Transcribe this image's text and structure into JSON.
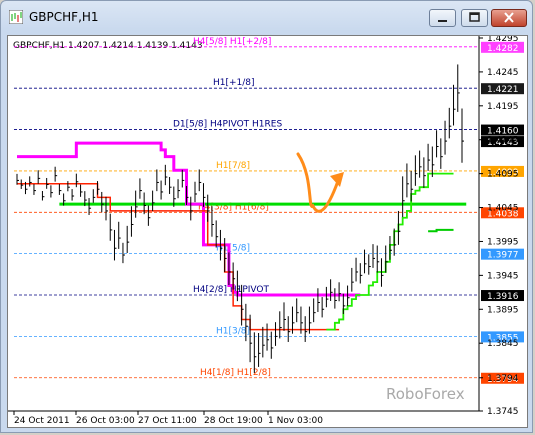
{
  "window": {
    "title": "GBPCHF,H1"
  },
  "chart_data": {
    "type": "line",
    "symbol_info": "GBPCHF,H1  1.4207 1.4214 1.4139 1.4143",
    "watermark": "RoboForex",
    "ylim": [
      1.3745,
      1.4295
    ],
    "y_ticks": [
      "1.4295",
      "1.4245",
      "1.4195",
      "1.4145",
      "1.4095",
      "1.4045",
      "1.3995",
      "1.3945",
      "1.3895",
      "1.3845",
      "1.3794",
      "1.3745"
    ],
    "x_tick_labels": [
      "24 Oct 2011",
      "26 Oct 03:00",
      "27 Oct 11:00",
      "28 Oct 19:00",
      "1 Nov 03:00"
    ],
    "levels": [
      {
        "label": "H4[5/8] H1[+2/8]",
        "value": 1.4282,
        "price": "1.4282",
        "color": "#ff00ff",
        "badge": "#ff40ff"
      },
      {
        "label": "H1[+1/8]",
        "value": 1.4221,
        "price": "1.4221",
        "color": "#000080",
        "badge": "#1a1a1a"
      },
      {
        "label": "D1[5/8] H4PIVOT H1RES",
        "value": 1.416,
        "price": "1.4160",
        "color": "#000080",
        "badge": "#000000"
      },
      {
        "label": "",
        "value": 1.4143,
        "price": "1.4143",
        "color": "#000000",
        "badge": "#000000"
      },
      {
        "label": "H1[7/8]",
        "value": 1.4099,
        "price": "1.4099",
        "color": "#ffa500",
        "badge": "#ffa500"
      },
      {
        "label": "H4[3/8] H1[6/8]",
        "value": 1.4038,
        "price": "1.4038",
        "color": "#ff4500",
        "badge": "#ff4500"
      },
      {
        "label": "H1[5/8]",
        "value": 1.3977,
        "price": "1.3977",
        "color": "#3399ff",
        "badge": "#3399ff"
      },
      {
        "label": "H4[2/8] H1PIVOT",
        "value": 1.3916,
        "price": "1.3916",
        "color": "#000080",
        "badge": "#000000"
      },
      {
        "label": "H1[3/8]",
        "value": 1.3855,
        "price": "1.3855",
        "color": "#3399ff",
        "badge": "#3399ff"
      },
      {
        "label": "H4[1/8] H1[2/8]",
        "value": 1.3794,
        "price": "1.3794",
        "color": "#ff4500",
        "badge": "#ff4500"
      }
    ],
    "price_close": [
      1.4085,
      1.4078,
      1.4072,
      1.4082,
      1.407,
      1.4088,
      1.4061,
      1.4079,
      1.4067,
      1.4092,
      1.407,
      1.4055,
      1.4075,
      1.4062,
      1.4083,
      1.4068,
      1.4056,
      1.4044,
      1.406,
      1.4072,
      1.405,
      1.404,
      1.4012,
      1.3985,
      1.4,
      1.3975,
      1.3994,
      1.402,
      1.4046,
      1.407,
      1.4048,
      1.403,
      1.4052,
      1.4082,
      1.4068,
      1.409,
      1.4075,
      1.4058,
      1.407,
      1.4085,
      1.406,
      1.404,
      1.4065,
      1.4082,
      1.406,
      1.404,
      1.402,
      1.4002,
      1.3985,
      1.397,
      1.395,
      1.394,
      1.3925,
      1.3895,
      1.387,
      1.3845,
      1.3825,
      1.383,
      1.3842,
      1.385,
      1.3838,
      1.3855,
      1.3868,
      1.388,
      1.3862,
      1.3875,
      1.389,
      1.3875,
      1.3862,
      1.3875,
      1.389,
      1.3905,
      1.3895,
      1.391,
      1.392,
      1.3908,
      1.3918,
      1.39,
      1.3912,
      1.3935,
      1.395,
      1.3945,
      1.3962,
      1.3958,
      1.397,
      1.3965,
      1.3945,
      1.3965,
      1.3982,
      1.399,
      1.401,
      1.4055,
      1.408,
      1.4072,
      1.4095,
      1.4105,
      1.4092,
      1.4115,
      1.4108,
      1.4135,
      1.412,
      1.4143,
      1.4165,
      1.419,
      1.4214,
      1.4143
    ],
    "price_range": [
      0.0016,
      0.0014,
      0.0018,
      0.0015,
      0.0016,
      0.002,
      0.0014,
      0.0016,
      0.0018,
      0.0022,
      0.0016,
      0.0018,
      0.0015,
      0.0017,
      0.002,
      0.0018,
      0.0022,
      0.0025,
      0.002,
      0.002,
      0.003,
      0.0035,
      0.004,
      0.0045,
      0.004,
      0.003,
      0.004,
      0.0045,
      0.004,
      0.003,
      0.0032,
      0.003,
      0.003,
      0.0032,
      0.0028,
      0.003,
      0.0025,
      0.003,
      0.0028,
      0.0026,
      0.0028,
      0.0035,
      0.003,
      0.0032,
      0.0035,
      0.004,
      0.0045,
      0.004,
      0.0045,
      0.005,
      0.0048,
      0.004,
      0.0045,
      0.006,
      0.0055,
      0.007,
      0.006,
      0.005,
      0.0045,
      0.004,
      0.004,
      0.0035,
      0.004,
      0.0042,
      0.0038,
      0.004,
      0.0035,
      0.004,
      0.0038,
      0.004,
      0.0035,
      0.0035,
      0.003,
      0.003,
      0.0032,
      0.003,
      0.0028,
      0.003,
      0.003,
      0.0035,
      0.0035,
      0.003,
      0.0035,
      0.003,
      0.0035,
      0.004,
      0.0042,
      0.004,
      0.0035,
      0.004,
      0.005,
      0.006,
      0.005,
      0.0045,
      0.0045,
      0.004,
      0.0045,
      0.004,
      0.0045,
      0.004,
      0.0045,
      0.005,
      0.0045,
      0.006,
      0.007,
      0.008
    ],
    "magenta_line": [
      1.412,
      1.412,
      1.412,
      1.412,
      1.412,
      1.412,
      1.412,
      1.412,
      1.412,
      1.412,
      1.412,
      1.412,
      1.412,
      1.412,
      1.414,
      1.414,
      1.414,
      1.414,
      1.414,
      1.414,
      1.414,
      1.414,
      1.414,
      1.414,
      1.414,
      1.414,
      1.414,
      1.414,
      1.414,
      1.414,
      1.414,
      1.414,
      1.414,
      1.414,
      1.413,
      1.412,
      1.412,
      1.41,
      1.41,
      1.41,
      1.405,
      1.405,
      1.405,
      1.405,
      1.399,
      1.399,
      1.399,
      1.399,
      1.399,
      1.399,
      1.393,
      1.392,
      1.3916,
      1.3916,
      1.3916,
      1.3916,
      1.3916,
      1.3916,
      1.3916,
      1.3916,
      1.3916,
      1.3916,
      1.3916,
      1.3916,
      1.3916,
      1.3916,
      1.3916,
      1.3916,
      1.3916,
      1.3916,
      1.3916,
      1.3916,
      1.3916,
      1.3916,
      1.3916,
      1.3916,
      1.3916,
      1.3916,
      1.3916,
      1.3916,
      1.3916,
      1.3916,
      null,
      null,
      null,
      null,
      null,
      null,
      null,
      null,
      null,
      null,
      null,
      null,
      null,
      null,
      null,
      null,
      null,
      null,
      null,
      null,
      null,
      null,
      null,
      null,
      null
    ],
    "red_line": [
      1.408,
      1.408,
      1.408,
      1.408,
      1.408,
      1.408,
      1.408,
      1.408,
      1.408,
      1.408,
      1.408,
      1.408,
      1.408,
      1.408,
      1.408,
      1.408,
      1.408,
      1.408,
      1.408,
      1.406,
      1.406,
      1.406,
      1.404,
      1.404,
      1.404,
      1.404,
      1.404,
      1.404,
      1.404,
      1.404,
      1.404,
      1.404,
      1.404,
      1.404,
      1.404,
      1.404,
      1.404,
      1.404,
      1.404,
      1.404,
      1.404,
      1.404,
      1.404,
      1.404,
      1.404,
      1.399,
      1.399,
      1.399,
      1.399,
      1.395,
      1.395,
      1.39,
      1.39,
      1.388,
      1.388,
      1.3865,
      1.3865,
      1.3865,
      1.3865,
      1.3865,
      1.3865,
      1.3865,
      1.3865,
      1.3865,
      1.3865,
      1.3865,
      1.3865,
      1.3865,
      1.3865,
      1.3865,
      1.3865,
      1.3865,
      1.3865,
      1.3865,
      1.3865,
      1.3865,
      1.3865,
      null,
      null,
      null,
      null,
      null,
      null,
      null,
      null,
      null,
      null,
      null,
      null,
      null,
      null,
      null,
      null,
      null,
      null,
      null,
      null,
      null,
      null,
      null,
      null,
      null,
      null,
      null,
      null,
      null,
      null
    ],
    "green_line": [
      null,
      null,
      null,
      null,
      null,
      null,
      null,
      null,
      null,
      null,
      1.405,
      1.405,
      1.405,
      1.405,
      1.405,
      1.405,
      1.405,
      1.405,
      1.405,
      1.405,
      1.405,
      1.405,
      1.405,
      1.405,
      1.405,
      1.405,
      1.405,
      1.405,
      1.405,
      1.405,
      1.405,
      1.405,
      1.405,
      1.405,
      1.405,
      1.405,
      1.405,
      1.405,
      1.405,
      1.405,
      1.405,
      1.405,
      1.405,
      1.405,
      1.405,
      1.405,
      1.405,
      1.405,
      1.405,
      1.405,
      1.405,
      1.405,
      1.405,
      1.405,
      1.405,
      1.405,
      1.405,
      1.405,
      1.405,
      1.405,
      1.405,
      1.405,
      1.405,
      1.405,
      1.405,
      1.405,
      1.405,
      1.405,
      1.405,
      1.405,
      1.405,
      1.405,
      1.405,
      1.405,
      1.405,
      1.405,
      1.405,
      1.405,
      1.405,
      1.405,
      1.405,
      1.405,
      1.405,
      1.405,
      1.405,
      1.405,
      1.405,
      1.405,
      1.405,
      1.405,
      1.405,
      1.405,
      1.405,
      1.405,
      1.405,
      1.405,
      1.405,
      1.405,
      1.405,
      1.405,
      1.405,
      1.405,
      1.405,
      1.405,
      1.405,
      1.405,
      1.405
    ],
    "green_trail": [
      null,
      null,
      null,
      null,
      null,
      null,
      null,
      null,
      null,
      null,
      null,
      null,
      null,
      null,
      null,
      null,
      null,
      null,
      null,
      null,
      null,
      null,
      null,
      null,
      null,
      null,
      null,
      null,
      null,
      null,
      null,
      null,
      null,
      null,
      null,
      null,
      null,
      null,
      null,
      null,
      null,
      null,
      null,
      null,
      null,
      null,
      null,
      null,
      null,
      null,
      null,
      null,
      null,
      null,
      null,
      null,
      null,
      null,
      null,
      null,
      null,
      null,
      null,
      null,
      null,
      null,
      null,
      null,
      null,
      null,
      null,
      null,
      null,
      1.3865,
      1.3865,
      1.3875,
      1.388,
      1.3895,
      1.39,
      1.391,
      1.3916,
      1.3916,
      1.3916,
      1.393,
      1.3935,
      1.395,
      1.395,
      1.3965,
      1.399,
      1.401,
      1.402,
      1.403,
      1.404,
      1.4065,
      1.407,
      1.4075,
      1.4075,
      1.4095,
      1.4095,
      1.4095,
      1.4095,
      1.4095,
      1.4095,
      1.4095,
      null
    ],
    "green_trail2": [
      null,
      null,
      null,
      null,
      null,
      null,
      null,
      null,
      null,
      null,
      null,
      null,
      null,
      null,
      null,
      null,
      null,
      null,
      null,
      null,
      null,
      null,
      null,
      null,
      null,
      null,
      null,
      null,
      null,
      null,
      null,
      null,
      null,
      null,
      null,
      null,
      null,
      null,
      null,
      null,
      null,
      null,
      null,
      null,
      null,
      null,
      null,
      null,
      null,
      null,
      null,
      null,
      null,
      null,
      null,
      null,
      null,
      null,
      null,
      null,
      null,
      null,
      null,
      null,
      null,
      null,
      null,
      null,
      null,
      null,
      null,
      null,
      null,
      null,
      null,
      null,
      null,
      null,
      null,
      null,
      null,
      null,
      null,
      null,
      null,
      null,
      null,
      null,
      null,
      null,
      null,
      null,
      null,
      null,
      null,
      null,
      null,
      1.401,
      1.401,
      1.4012,
      1.4012,
      1.4012,
      1.4012,
      1.4012,
      null
    ],
    "forecast_arrow_color": "#ff8c1a"
  }
}
